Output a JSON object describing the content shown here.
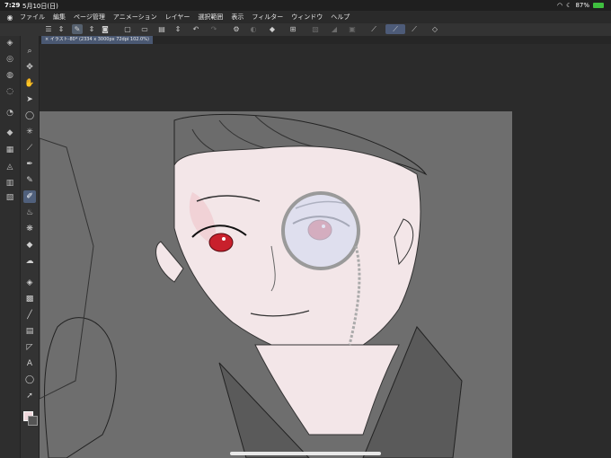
{
  "status": {
    "time": "7:29",
    "date": "5月10日(日)",
    "battery": "87%"
  },
  "menu": {
    "items": [
      "ファイル",
      "編集",
      "ページ管理",
      "アニメーション",
      "レイヤー",
      "選択範囲",
      "表示",
      "フィルター",
      "ウィンドウ",
      "ヘルプ"
    ]
  },
  "canvas_tab": {
    "label": "イラスト-80* (2334 x 3000px 72dpi 102.0%)"
  },
  "tools": {
    "text_tool_glyph": "A"
  },
  "colors": {
    "artboard_bg": "#6e6e6e",
    "skin": "#f3e6e8",
    "eye": "#c8202c",
    "monocle_lens": "#d8dcf0",
    "ui_dark": "#2b2b2b"
  }
}
